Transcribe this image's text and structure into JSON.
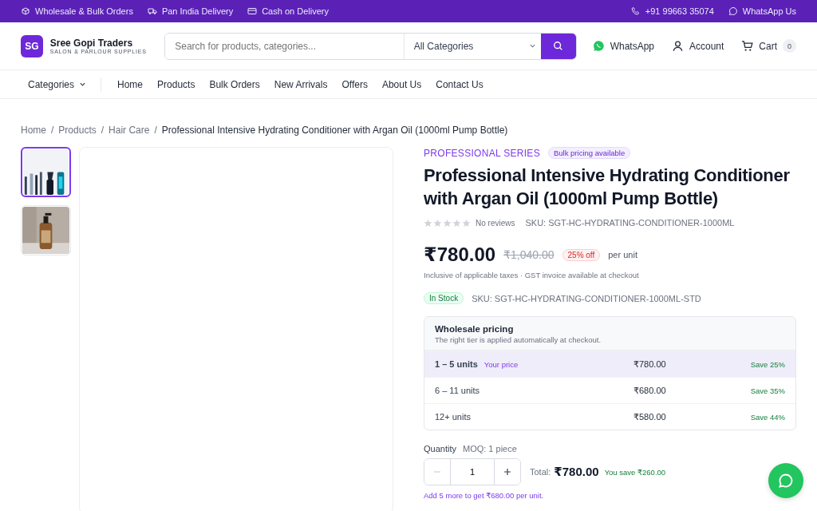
{
  "top_bar": {
    "left": [
      {
        "label": "Wholesale & Bulk Orders"
      },
      {
        "label": "Pan India Delivery"
      },
      {
        "label": "Cash on Delivery"
      }
    ],
    "right": [
      {
        "label": "+91 99663 35074"
      },
      {
        "label": "WhatsApp Us"
      }
    ]
  },
  "header": {
    "logo_mark": "SG",
    "brand": "Sree Gopi Traders",
    "tagline": "SALON & PARLOUR SUPPLIES",
    "search": {
      "placeholder": "Search for products, categories..."
    },
    "category_select": "All Categories",
    "actions": [
      {
        "label": "WhatsApp"
      },
      {
        "label": "Account"
      },
      {
        "label": "Cart",
        "badge": "0"
      }
    ]
  },
  "nav": {
    "categories": "Categories",
    "links": [
      "Home",
      "Products",
      "Bulk Orders",
      "New Arrivals",
      "Offers",
      "About Us",
      "Contact Us"
    ]
  },
  "breadcrumb": {
    "separator": "/",
    "items": [
      "Home",
      "Products",
      "Hair Care",
      "Professional Intensive Hydrating Conditioner with Argan Oil (1000ml Pump Bottle)"
    ]
  },
  "gallery": {
    "thumbnails": [
      {
        "kind": "picture",
        "selected": true
      },
      {
        "kind": "picture",
        "selected": false
      }
    ]
  },
  "product": {
    "series": "PROFESSIONAL SERIES",
    "tag": "Bulk pricing available",
    "title": "Professional Intensive Hydrating Conditioner with Argan Oil (1000ml Pump Bottle)",
    "stars": 0,
    "reviews": "No reviews",
    "sku": "SKU: SGT-HC-HYDRATING-CONDITIONER-1000ML",
    "price": "₹780.00",
    "old_price": "₹1,040.00",
    "discount": "25% off",
    "unit": "per unit",
    "tax_note": "Inclusive of applicable taxes · GST invoice available at checkout",
    "stock": "In Stock",
    "variant_sku": "SKU: SGT-HC-HYDRATING-CONDITIONER-1000ML-STD"
  },
  "wholesale": {
    "title": "Wholesale pricing",
    "subtitle": "The right tier is applied automatically at checkout.",
    "tiers": [
      {
        "range": "1 – 5 units",
        "note": "Your price",
        "price": "₹780.00",
        "save": "Save 25%",
        "selected": true
      },
      {
        "range": "6 – 11 units",
        "price": "₹680.00",
        "save": "Save 35%",
        "selected": false
      },
      {
        "range": "12+ units",
        "price": "₹580.00",
        "save": "Save 44%",
        "selected": false
      }
    ]
  },
  "quantity": {
    "label": "Quantity",
    "moq": "MOQ: 1 piece",
    "value": "1",
    "minus_disabled": true,
    "total_label": "Total:",
    "total": "₹780.00",
    "savings": "You save ₹260.00",
    "hint": "Add 5 more to get ₹680.00 per unit."
  }
}
